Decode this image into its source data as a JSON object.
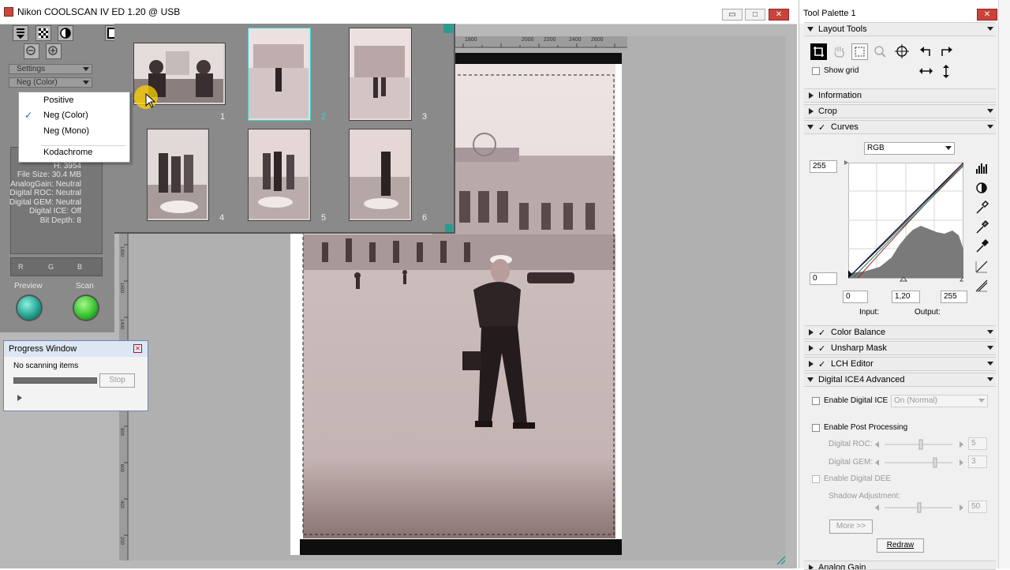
{
  "app": {
    "title": "Nikon COOLSCAN IV ED 1.20 @ USB",
    "window_buttons": {
      "minimize": "▭",
      "maximize": "□",
      "close": "✕"
    }
  },
  "left_panel": {
    "settings_label": "Settings",
    "film_type_value": "Neg (Color)",
    "info_lines": [
      "H: 3954",
      "File Size: 30.4 MB",
      "AnalogGain: Neutral",
      "Digital ROC: Neutral",
      "Digital GEM: Neutral",
      "Digital ICE: Off",
      "Bit Depth: 8"
    ],
    "histogram_labels": [
      "R",
      "G",
      "B"
    ],
    "preview_label": "Preview",
    "scan_label": "Scan"
  },
  "film_type_menu": {
    "items": [
      "Positive",
      "Neg (Color)",
      "Neg (Mono)",
      "Kodachrome"
    ],
    "checked": "Neg (Color)",
    "check_glyph": "✓"
  },
  "thumbnails": {
    "numbers": [
      "1",
      "2",
      "3",
      "4",
      "5",
      "6"
    ],
    "selected": "2"
  },
  "ruler_top_labels": [
    "1800",
    "2000",
    "2200",
    "2400",
    "2600"
  ],
  "ruler_left_labels": [
    "1800",
    "1600",
    "1400",
    "1200",
    "1000",
    "800",
    "600",
    "400",
    "200"
  ],
  "progress_window": {
    "title": "Progress Window",
    "status": "No scanning items",
    "stop_label": "Stop",
    "progress": 0
  },
  "tool_palette": {
    "title": "Tool Palette 1",
    "layout_tools": {
      "label": "Layout Tools",
      "show_grid_label": "Show grid"
    },
    "information_label": "Information",
    "crop_label": "Crop",
    "curves": {
      "label": "Curves",
      "channel": "RGB",
      "top_value": "255",
      "bottom_value": "0",
      "input_min": "0",
      "gamma": "1,20",
      "input_max": "255",
      "input_label": "Input:",
      "output_label": "Output:"
    },
    "color_balance_label": "Color Balance",
    "unsharp_mask_label": "Unsharp Mask",
    "lch_editor_label": "LCH Editor",
    "ice": {
      "label": "Digital ICE4 Advanced",
      "enable_ice_label": "Enable Digital ICE",
      "ice_mode": "On (Normal)",
      "enable_post_label": "Enable Post Processing",
      "roc_label": "Digital ROC:",
      "roc_value": "5",
      "gem_label": "Digital GEM:",
      "gem_value": "3",
      "dee_label": "Enable Digital DEE",
      "shadow_label": "Shadow Adjustment:",
      "shadow_value": "50",
      "more_label": "More >>",
      "redraw_label": "Redraw"
    },
    "analog_gain_label": "Analog Gain"
  }
}
